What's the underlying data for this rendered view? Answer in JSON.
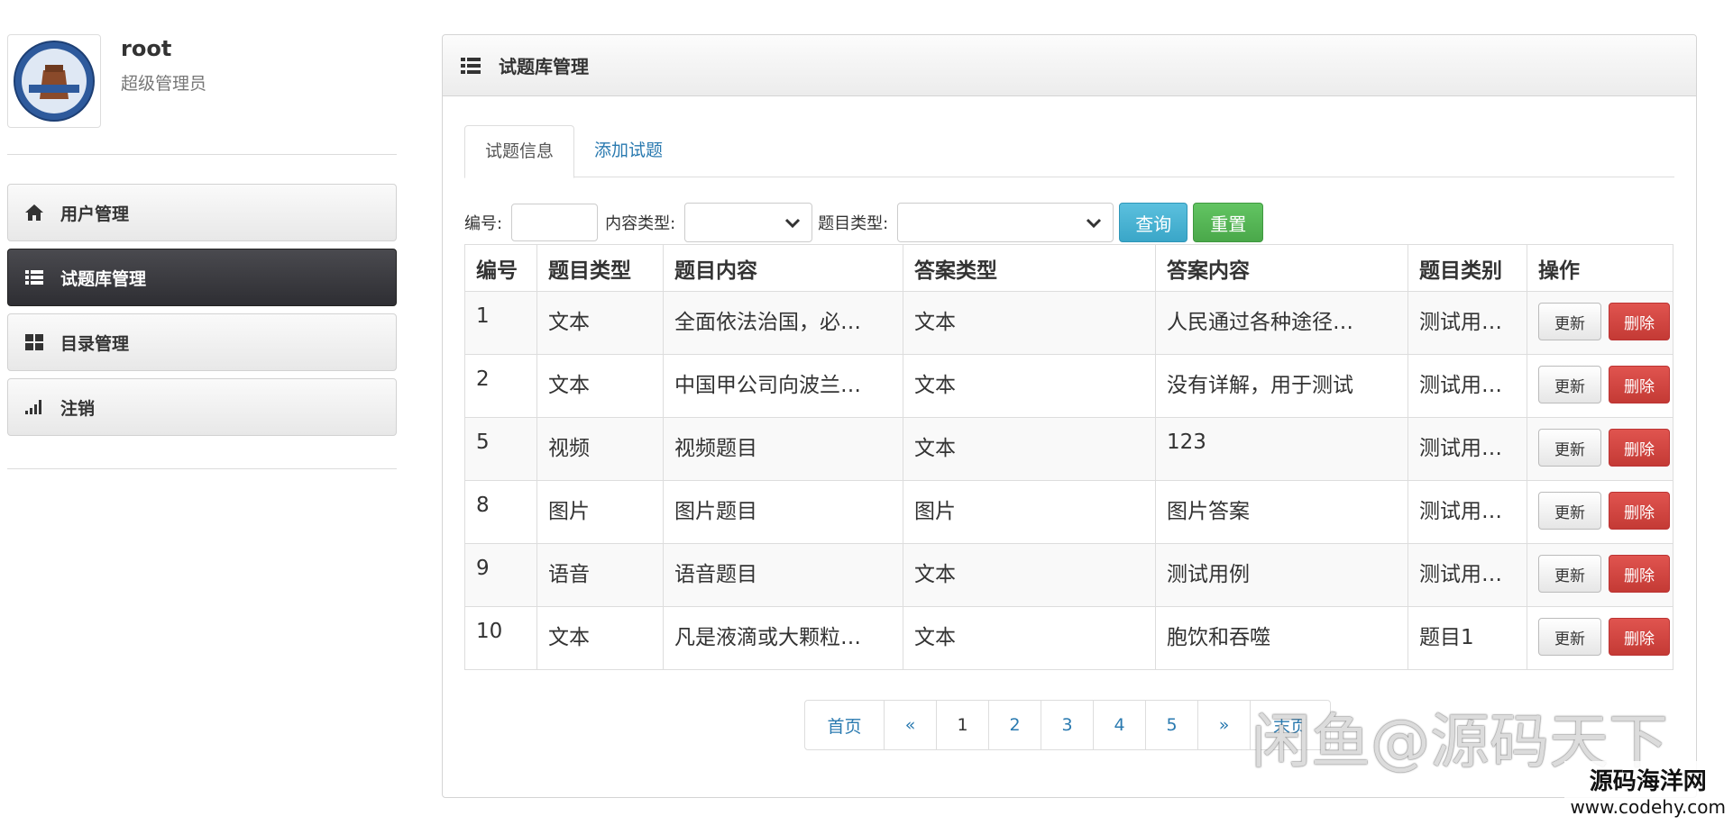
{
  "profile": {
    "username": "root",
    "role": "超级管理员"
  },
  "sidebar": {
    "items": [
      {
        "label": "用户管理",
        "icon": "home-icon",
        "active": false
      },
      {
        "label": "试题库管理",
        "icon": "list-icon",
        "active": true
      },
      {
        "label": "目录管理",
        "icon": "grid-icon",
        "active": false
      },
      {
        "label": "注销",
        "icon": "signal-icon",
        "active": false
      }
    ]
  },
  "panel": {
    "title": "试题库管理",
    "icon": "list-icon"
  },
  "tabs": [
    {
      "label": "试题信息",
      "active": true
    },
    {
      "label": "添加试题",
      "active": false
    }
  ],
  "search": {
    "id_label": "编号:",
    "id_value": "",
    "content_type_label": "内容类型:",
    "content_type_value": "",
    "question_type_label": "题目类型:",
    "question_type_value": "",
    "query_button": "查询",
    "reset_button": "重置"
  },
  "table": {
    "headers": [
      "编号",
      "题目类型",
      "题目内容",
      "答案类型",
      "答案内容",
      "题目类别",
      "操作"
    ],
    "update_label": "更新",
    "delete_label": "删除",
    "rows": [
      [
        "1",
        "文本",
        "全面依法治国，必…",
        "文本",
        "人民通过各种途径…",
        "测试用…"
      ],
      [
        "2",
        "文本",
        "中国甲公司向波兰…",
        "文本",
        "没有详解，用于测试",
        "测试用…"
      ],
      [
        "5",
        "视频",
        "视频题目",
        "文本",
        "123",
        "测试用…"
      ],
      [
        "8",
        "图片",
        "图片题目",
        "图片",
        "图片答案",
        "测试用…"
      ],
      [
        "9",
        "语音",
        "语音题目",
        "文本",
        "测试用例",
        "测试用…"
      ],
      [
        "10",
        "文本",
        "凡是液滴或大颗粒…",
        "文本",
        "胞饮和吞噬",
        "题目1"
      ]
    ]
  },
  "pagination": {
    "first": "首页",
    "prev": "«",
    "pages": [
      "1",
      "2",
      "3",
      "4",
      "5"
    ],
    "current": "1",
    "next": "»",
    "last": "末页"
  },
  "watermark": {
    "text": "闲鱼@源码天下",
    "site_name": "源码海洋网",
    "site_url": "www.codehy.com"
  },
  "colors": {
    "link": "#2a7ab0",
    "active_menu": "#3a3a3f",
    "info_button": "#5bc0de",
    "success_button": "#5cb85c",
    "danger_button": "#d9534f"
  }
}
